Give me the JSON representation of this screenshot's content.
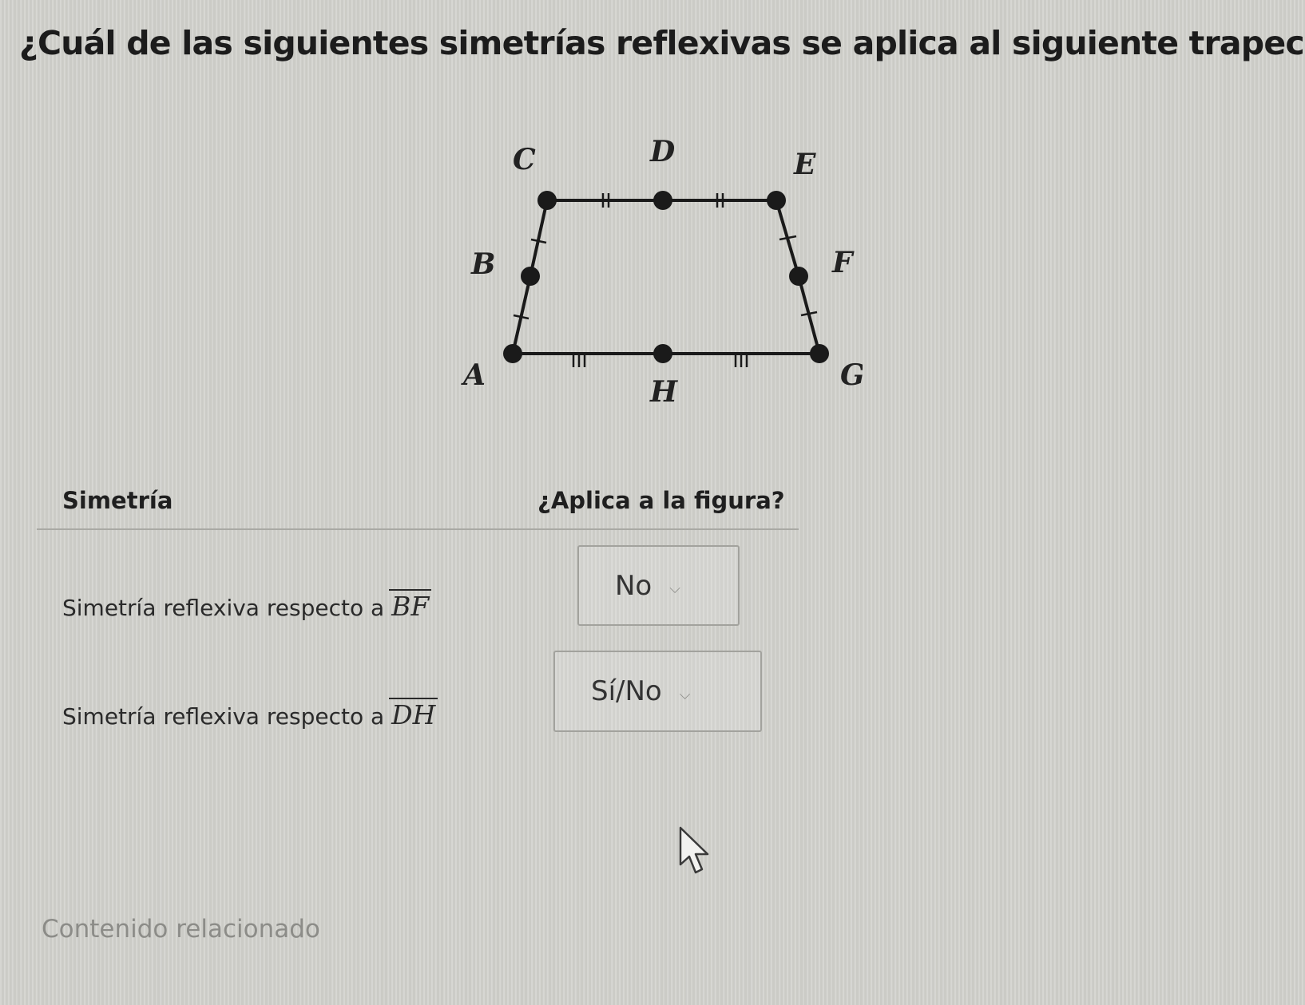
{
  "question": "¿Cuál de las siguientes simetrías reflexivas se aplica al siguiente trapecio?",
  "figure": {
    "points": {
      "A": "A",
      "B": "B",
      "C": "C",
      "D": "D",
      "E": "E",
      "F": "F",
      "G": "G",
      "H": "H"
    }
  },
  "table": {
    "header_symmetry": "Simetría",
    "header_applies": "¿Aplica a la figura?",
    "rows": [
      {
        "label": "Simetría reflexiva respecto a",
        "segment": "BF",
        "selected": "No"
      },
      {
        "label": "Simetría reflexiva respecto a",
        "segment": "DH",
        "selected": "Sí/No"
      }
    ]
  },
  "related": "Contenido relacionado",
  "icons": {
    "chevron": "chevron-down-icon",
    "cursor": "mouse-pointer-icon"
  }
}
